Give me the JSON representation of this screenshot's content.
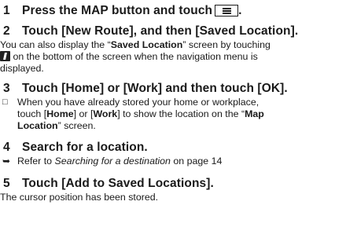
{
  "step1": {
    "num": "1",
    "text": "Press the MAP button and touch",
    "icon": "menu-icon",
    "end": "."
  },
  "step2": {
    "num": "2",
    "text": "Touch [New Route], and then [Saved Location].",
    "body_l1_a": "You can also display the “",
    "body_l1_bold": "Saved Location",
    "body_l1_b": "” screen by touching",
    "body_icon": "map-pin-icon",
    "body_l2": " on the bottom of the screen when the navigation menu is",
    "body_l3": "displayed."
  },
  "step3": {
    "num": "3",
    "text": "Touch [Home] or [Work] and then touch [OK].",
    "note_l1": "When you have already stored your home or workplace,",
    "note_l2_a": "touch [",
    "note_l2_home": "Home",
    "note_l2_b": "] or [",
    "note_l2_work": "Work",
    "note_l2_c": "] to show the location on the “",
    "note_l2_map": "Map",
    "note_l3_loc": "Location",
    "note_l3_b": "” screen."
  },
  "step4": {
    "num": "4",
    "text": "Search for a location.",
    "ref_a": "Refer to ",
    "ref_italic": "Searching for a destination",
    "ref_b": " on page 14"
  },
  "step5": {
    "num": "5",
    "text": "Touch [Add to Saved Locations].",
    "body": "The cursor position has been stored."
  }
}
